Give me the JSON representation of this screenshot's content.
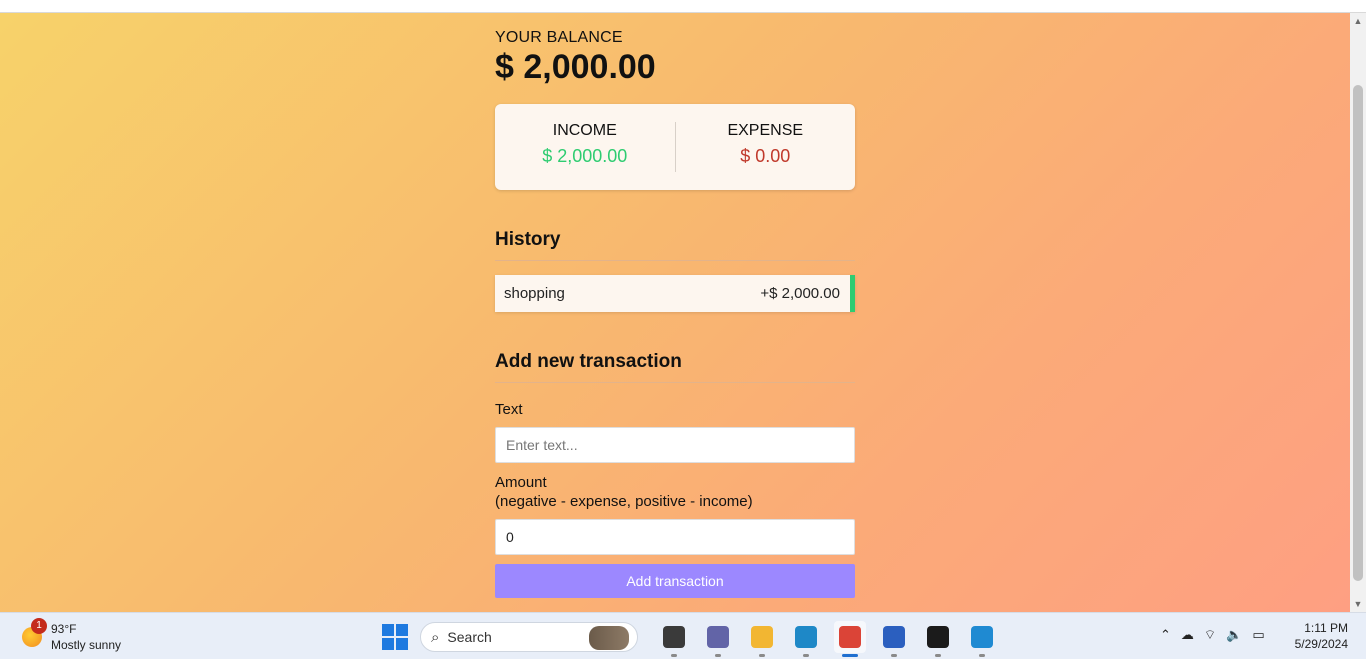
{
  "balance": {
    "label": "YOUR BALANCE",
    "value": "$ 2,000.00"
  },
  "summary": {
    "income_label": "INCOME",
    "income_value": "$ 2,000.00",
    "expense_label": "EXPENSE",
    "expense_value": "$ 0.00"
  },
  "history": {
    "title": "History",
    "items": [
      {
        "text": "shopping",
        "amount": "+$ 2,000.00",
        "type": "plus"
      }
    ]
  },
  "form": {
    "title": "Add new transaction",
    "text_label": "Text",
    "text_placeholder": "Enter text...",
    "text_value": "",
    "amount_label": "Amount",
    "amount_hint": "(negative - expense, positive - income)",
    "amount_value": "0",
    "submit_label": "Add transaction"
  },
  "colors": {
    "plus": "#2ecc71",
    "minus": "#c0392b",
    "button": "#9c88ff"
  },
  "taskbar": {
    "weather_badge": "1",
    "weather_temp": "93°F",
    "weather_desc": "Mostly sunny",
    "search_label": "Search",
    "apps": [
      {
        "name": "task-view-icon",
        "color": "#3a3a3a",
        "active": false
      },
      {
        "name": "teams-chat-icon",
        "color": "#6264a7",
        "active": false
      },
      {
        "name": "file-explorer-icon",
        "color": "#f2b632",
        "active": false
      },
      {
        "name": "edge-icon",
        "color": "#1e88c7",
        "active": false
      },
      {
        "name": "chrome-icon",
        "color": "#db4437",
        "active": true
      },
      {
        "name": "microsoft-store-icon",
        "color": "#2b5fbf",
        "active": false
      },
      {
        "name": "terminal-icon",
        "color": "#1b1b1b",
        "active": false
      },
      {
        "name": "vscode-icon",
        "color": "#1f8ad2",
        "active": false
      }
    ],
    "time": "1:11 PM",
    "date": "5/29/2024"
  }
}
